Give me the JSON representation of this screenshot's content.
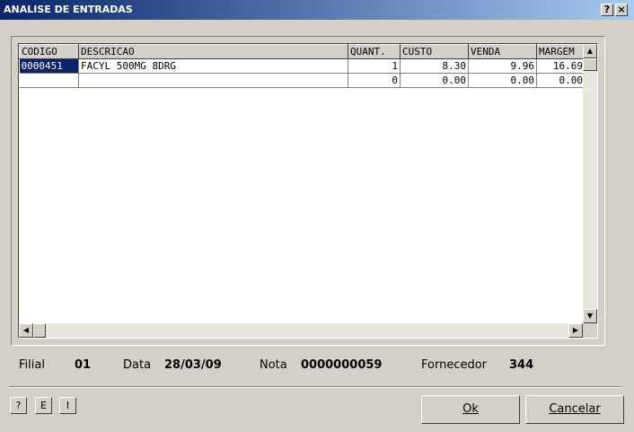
{
  "window": {
    "title": "ANALISE DE ENTRADAS",
    "help_label": "?",
    "close_label": "×"
  },
  "grid": {
    "columns": [
      "CODIGO",
      "DESCRICAO",
      "QUANT.",
      "CUSTO",
      "VENDA",
      "MARGEM"
    ],
    "rows": [
      {
        "codigo": "0000451",
        "descricao": "FACYL 500MG 8DRG",
        "quant": "1",
        "custo": "8.30",
        "venda": "9.96",
        "margem": "16.69"
      },
      {
        "codigo": "",
        "descricao": "",
        "quant": "0",
        "custo": "0.00",
        "venda": "0.00",
        "margem": "0.00"
      }
    ]
  },
  "info": {
    "filial_label": "Filial",
    "filial_value": "01",
    "data_label": "Data",
    "data_value": "28/03/09",
    "nota_label": "Nota",
    "nota_value": "0000000059",
    "fornecedor_label": "Fornecedor",
    "fornecedor_value": "344"
  },
  "buttons": {
    "help": "?",
    "e": "E",
    "i": "I",
    "ok": "Ok",
    "cancel": "Cancelar"
  },
  "colors": {
    "selection": "#0a246a",
    "face": "#d4d0c8"
  }
}
